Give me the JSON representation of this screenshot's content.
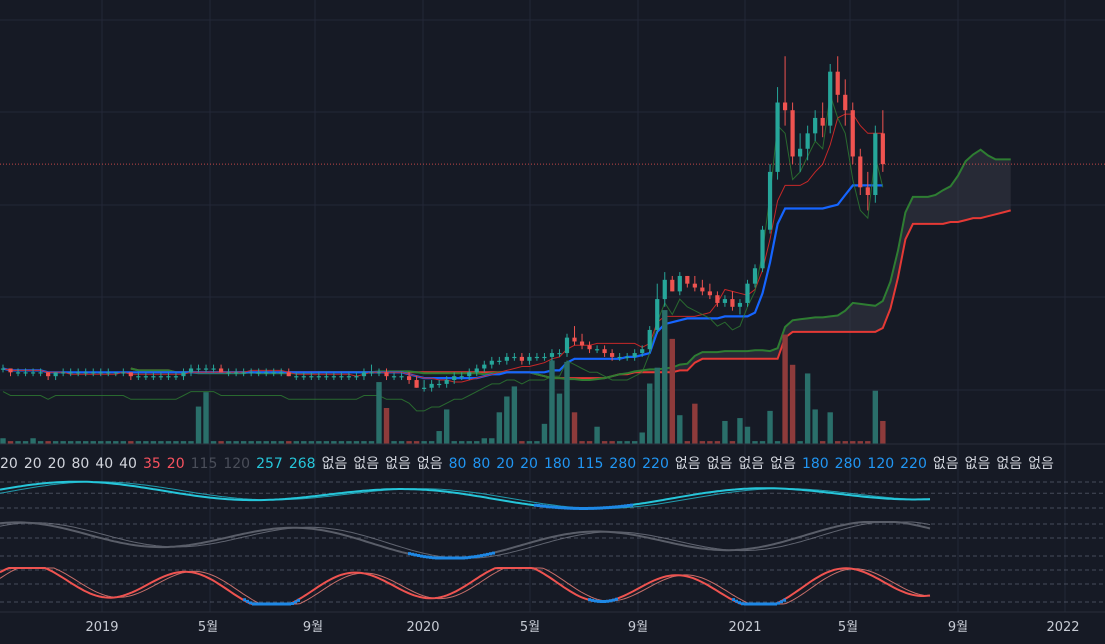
{
  "colors": {
    "background": "#161a25",
    "grid": "#232838",
    "up": "#26a69a",
    "down": "#ef5350",
    "volume_up": "#2a6f6a",
    "volume_down": "#8e3b3b",
    "cloud_span_a": "#2e7d32",
    "cloud_span_b": "#e53935",
    "cloud_fill": "#3b3f4b",
    "baseline": "#1565ff",
    "tenkan": "#c62828",
    "lagging": "#2e7d32",
    "osc_cyan": "#26c6da",
    "osc_gray": "#5a5e69",
    "osc_red": "#ef5350",
    "osc_blue": "#1e88e5"
  },
  "status_values": [
    {
      "text": "20",
      "tone": "neutral"
    },
    {
      "text": "20",
      "tone": "neutral"
    },
    {
      "text": "20",
      "tone": "neutral"
    },
    {
      "text": "80",
      "tone": "neutral"
    },
    {
      "text": "40",
      "tone": "neutral"
    },
    {
      "text": "40",
      "tone": "neutral"
    },
    {
      "text": "35",
      "tone": "red"
    },
    {
      "text": "20",
      "tone": "red"
    },
    {
      "text": "115",
      "tone": "dim"
    },
    {
      "text": "120",
      "tone": "dim"
    },
    {
      "text": "257",
      "tone": "cyan"
    },
    {
      "text": "268",
      "tone": "cyan"
    },
    {
      "text": "없음",
      "tone": "neutral"
    },
    {
      "text": "없음",
      "tone": "neutral"
    },
    {
      "text": "없음",
      "tone": "neutral"
    },
    {
      "text": "없음",
      "tone": "neutral"
    },
    {
      "text": "80",
      "tone": "blue"
    },
    {
      "text": "80",
      "tone": "blue"
    },
    {
      "text": "20",
      "tone": "blue"
    },
    {
      "text": "20",
      "tone": "blue"
    },
    {
      "text": "180",
      "tone": "blue"
    },
    {
      "text": "115",
      "tone": "blue"
    },
    {
      "text": "280",
      "tone": "blue"
    },
    {
      "text": "220",
      "tone": "blue"
    },
    {
      "text": "없음",
      "tone": "neutral"
    },
    {
      "text": "없음",
      "tone": "neutral"
    },
    {
      "text": "없음",
      "tone": "neutral"
    },
    {
      "text": "없음",
      "tone": "neutral"
    },
    {
      "text": "180",
      "tone": "blue"
    },
    {
      "text": "280",
      "tone": "blue"
    },
    {
      "text": "120",
      "tone": "blue"
    },
    {
      "text": "220",
      "tone": "blue"
    },
    {
      "text": "없음",
      "tone": "neutral"
    },
    {
      "text": "없음",
      "tone": "neutral"
    },
    {
      "text": "없음",
      "tone": "neutral"
    },
    {
      "text": "없음",
      "tone": "neutral"
    }
  ],
  "chart_data": {
    "type": "candlestick",
    "title": "",
    "xlabel": "",
    "ylabel": "",
    "time_axis_labels": [
      "2019",
      "5월",
      "9월",
      "2020",
      "5월",
      "9월",
      "2021",
      "5월",
      "9월",
      "2022"
    ],
    "price_scale": "relative (0 = 2019 base level, 100 = 2021 peak)",
    "reference_line_level": 64,
    "candles": {
      "columns": [
        "open",
        "high",
        "low",
        "close"
      ],
      "values": [
        [
          11,
          12,
          10,
          11
        ],
        [
          11,
          11,
          9,
          10
        ],
        [
          10,
          11,
          9,
          10
        ],
        [
          10,
          11,
          9,
          10
        ],
        [
          10,
          11,
          9,
          10
        ],
        [
          10,
          11,
          9,
          10
        ],
        [
          10,
          10,
          8,
          9
        ],
        [
          9,
          10,
          8,
          10
        ],
        [
          10,
          11,
          9,
          10
        ],
        [
          10,
          11,
          9,
          10
        ],
        [
          10,
          11,
          9,
          10
        ],
        [
          10,
          11,
          9,
          10
        ],
        [
          10,
          11,
          9,
          10
        ],
        [
          10,
          11,
          9,
          10
        ],
        [
          10,
          11,
          9,
          10
        ],
        [
          10,
          10,
          9,
          10
        ],
        [
          10,
          11,
          9,
          10
        ],
        [
          10,
          10,
          8,
          9
        ],
        [
          9,
          10,
          8,
          9
        ],
        [
          9,
          10,
          8,
          9
        ],
        [
          9,
          10,
          8,
          9
        ],
        [
          9,
          10,
          8,
          9
        ],
        [
          9,
          10,
          8,
          9
        ],
        [
          9,
          10,
          8,
          9
        ],
        [
          9,
          11,
          8,
          10
        ],
        [
          10,
          12,
          9,
          11
        ],
        [
          11,
          12,
          10,
          11
        ],
        [
          11,
          12,
          10,
          11
        ],
        [
          11,
          12,
          10,
          11
        ],
        [
          11,
          12,
          10,
          10
        ],
        [
          10,
          11,
          9,
          10
        ],
        [
          10,
          11,
          9,
          10
        ],
        [
          10,
          11,
          9,
          10
        ],
        [
          10,
          11,
          9,
          10
        ],
        [
          10,
          11,
          9,
          10
        ],
        [
          10,
          11,
          9,
          10
        ],
        [
          10,
          11,
          9,
          10
        ],
        [
          10,
          11,
          9,
          10
        ],
        [
          10,
          11,
          9,
          9
        ],
        [
          9,
          10,
          8,
          9
        ],
        [
          9,
          10,
          8,
          9
        ],
        [
          9,
          10,
          8,
          9
        ],
        [
          9,
          10,
          8,
          9
        ],
        [
          9,
          10,
          8,
          9
        ],
        [
          9,
          10,
          8,
          9
        ],
        [
          9,
          10,
          8,
          9
        ],
        [
          9,
          10,
          8,
          9
        ],
        [
          9,
          10,
          8,
          9
        ],
        [
          9,
          11,
          8,
          10
        ],
        [
          10,
          12,
          9,
          10
        ],
        [
          10,
          11,
          9,
          10
        ],
        [
          10,
          11,
          8,
          9
        ],
        [
          9,
          10,
          8,
          9
        ],
        [
          9,
          10,
          8,
          9
        ],
        [
          9,
          10,
          7,
          8
        ],
        [
          8,
          9,
          6,
          6
        ],
        [
          6,
          8,
          5,
          6
        ],
        [
          6,
          8,
          5,
          7
        ],
        [
          7,
          8,
          6,
          7
        ],
        [
          7,
          9,
          6,
          8
        ],
        [
          8,
          10,
          7,
          9
        ],
        [
          9,
          10,
          8,
          9
        ],
        [
          9,
          11,
          8,
          10
        ],
        [
          10,
          12,
          9,
          11
        ],
        [
          11,
          13,
          10,
          12
        ],
        [
          12,
          14,
          11,
          13
        ],
        [
          13,
          14,
          12,
          13
        ],
        [
          13,
          15,
          12,
          14
        ],
        [
          14,
          15,
          13,
          14
        ],
        [
          14,
          15,
          12,
          13
        ],
        [
          13,
          15,
          12,
          14
        ],
        [
          14,
          15,
          13,
          14
        ],
        [
          14,
          15,
          13,
          14
        ],
        [
          14,
          16,
          13,
          15
        ],
        [
          15,
          16,
          14,
          15
        ],
        [
          15,
          20,
          14,
          19
        ],
        [
          19,
          22,
          17,
          18
        ],
        [
          18,
          20,
          16,
          17
        ],
        [
          17,
          18,
          15,
          16
        ],
        [
          16,
          17,
          15,
          16
        ],
        [
          16,
          17,
          14,
          15
        ],
        [
          15,
          16,
          13,
          14
        ],
        [
          14,
          15,
          13,
          14
        ],
        [
          14,
          15,
          13,
          14
        ],
        [
          14,
          16,
          13,
          15
        ],
        [
          15,
          17,
          14,
          16
        ],
        [
          16,
          22,
          15,
          21
        ],
        [
          21,
          33,
          20,
          29
        ],
        [
          29,
          36,
          27,
          34
        ],
        [
          34,
          35,
          31,
          31
        ],
        [
          31,
          36,
          30,
          35
        ],
        [
          35,
          35,
          32,
          33
        ],
        [
          33,
          35,
          31,
          32
        ],
        [
          32,
          34,
          30,
          31
        ],
        [
          31,
          33,
          29,
          30
        ],
        [
          30,
          31,
          27,
          28
        ],
        [
          28,
          30,
          27,
          29
        ],
        [
          29,
          31,
          26,
          27
        ],
        [
          27,
          29,
          25,
          28
        ],
        [
          28,
          34,
          27,
          33
        ],
        [
          33,
          38,
          32,
          37
        ],
        [
          37,
          48,
          36,
          47
        ],
        [
          47,
          64,
          46,
          62
        ],
        [
          62,
          84,
          60,
          80
        ],
        [
          80,
          92,
          74,
          78
        ],
        [
          78,
          80,
          64,
          66
        ],
        [
          66,
          72,
          62,
          68
        ],
        [
          68,
          74,
          65,
          72
        ],
        [
          72,
          78,
          70,
          76
        ],
        [
          76,
          80,
          71,
          74
        ],
        [
          74,
          90,
          72,
          88
        ],
        [
          88,
          92,
          80,
          82
        ],
        [
          82,
          86,
          74,
          78
        ],
        [
          78,
          80,
          64,
          66
        ],
        [
          66,
          68,
          56,
          58
        ],
        [
          58,
          62,
          52,
          56
        ],
        [
          56,
          74,
          54,
          72
        ],
        [
          72,
          78,
          62,
          64
        ]
      ]
    },
    "volume": [
      2,
      1,
      1,
      1,
      2,
      1,
      1,
      1,
      1,
      1,
      1,
      1,
      1,
      1,
      1,
      1,
      1,
      1,
      1,
      1,
      1,
      1,
      1,
      1,
      1,
      1,
      6,
      1,
      1,
      1,
      1,
      1,
      1,
      1,
      1,
      1,
      1,
      1,
      1,
      1,
      1,
      1,
      1,
      1,
      1,
      1,
      1,
      1,
      1,
      1,
      1,
      1,
      1,
      1,
      1,
      1,
      1,
      1,
      1,
      1,
      1,
      1,
      1,
      1,
      2,
      2,
      2,
      1,
      1,
      1,
      1,
      1,
      1,
      1,
      1,
      1,
      1,
      1,
      1,
      1,
      1,
      1,
      1,
      1,
      1,
      1,
      1,
      1,
      1,
      1,
      1,
      1,
      1,
      1,
      1,
      1,
      1,
      1,
      1,
      1,
      1,
      1,
      1,
      1,
      1,
      1,
      1,
      1,
      1,
      1,
      1,
      1,
      1,
      1,
      1,
      1,
      1,
      1,
      1,
      1,
      1,
      1,
      1,
      1,
      1,
      1,
      1,
      1,
      1,
      1,
      1,
      1,
      1,
      1,
      1,
      1,
      1,
      1,
      1,
      1,
      1,
      1,
      1,
      1,
      1,
      1,
      1,
      1,
      1,
      1,
      1,
      1,
      1,
      1,
      1,
      1,
      1,
      1,
      1,
      1,
      1,
      1,
      1,
      1,
      1,
      1,
      1,
      1,
      1,
      1,
      1,
      1,
      1,
      1,
      1,
      1,
      1,
      1,
      1,
      1,
      1,
      1,
      1,
      1,
      1,
      1,
      1,
      1,
      1,
      1,
      1,
      1,
      1,
      1,
      1,
      1,
      1,
      1,
      1,
      1,
      1,
      1,
      1,
      1,
      1,
      1,
      1,
      1,
      1,
      1,
      1,
      1,
      1,
      1,
      1,
      1,
      1,
      1,
      1,
      1,
      1,
      1,
      1,
      1,
      1,
      1,
      1,
      1,
      1,
      1,
      1,
      1,
      1,
      1,
      1,
      1,
      1,
      1,
      1,
      1,
      1,
      1,
      1,
      1,
      1,
      1,
      1,
      1,
      1,
      1,
      1,
      1,
      1,
      1,
      1,
      1
    ]
  }
}
